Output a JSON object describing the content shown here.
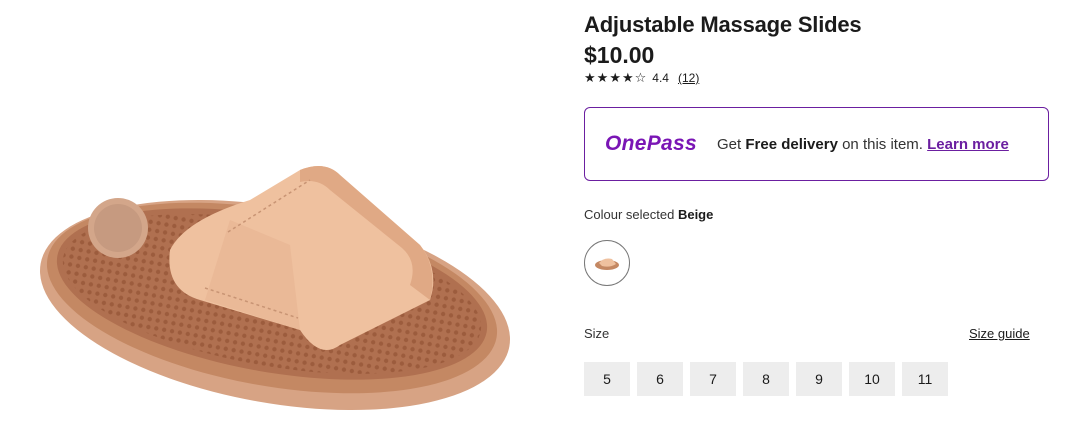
{
  "product": {
    "title": "Adjustable Massage Slides",
    "price": "$10.00",
    "rating": {
      "stars": 4.5,
      "value": "4.4",
      "reviews": "(12)"
    },
    "image_alt": "beige-massage-slide"
  },
  "onepass": {
    "logo": "OnePass",
    "text_get": "Get",
    "text_bold": "Free delivery",
    "text_rest": "on this item.",
    "link": "Learn more",
    "color": "#6b1fa0"
  },
  "colour": {
    "label": "Colour selected",
    "selected": "Beige"
  },
  "size": {
    "label": "Size",
    "guide": "Size guide",
    "options": [
      "5",
      "6",
      "7",
      "8",
      "9",
      "10",
      "11"
    ]
  }
}
